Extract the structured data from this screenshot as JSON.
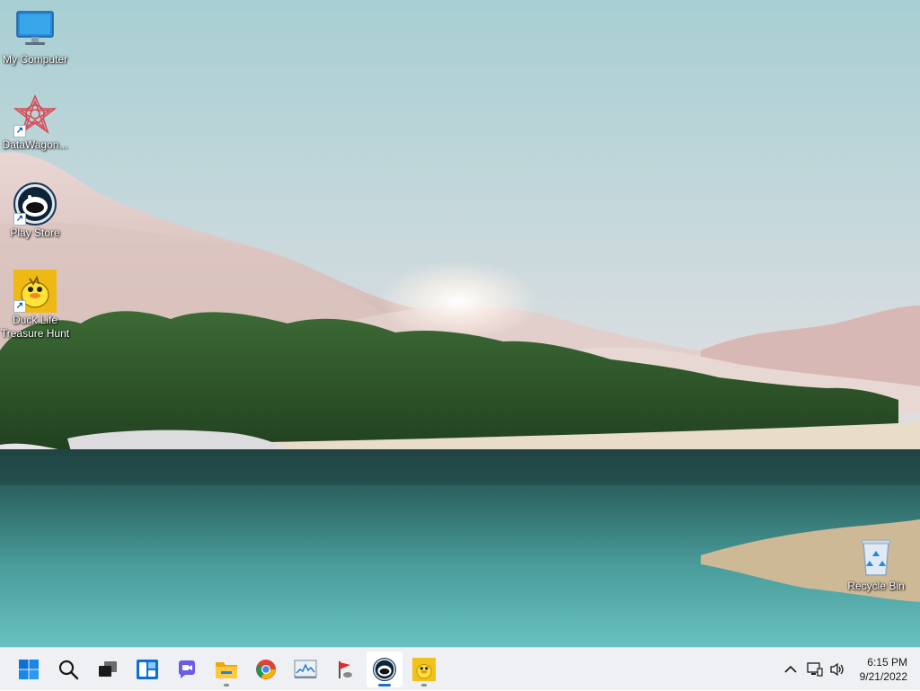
{
  "desktop": {
    "icons": [
      {
        "label": "My Computer",
        "icon": "monitor-icon"
      },
      {
        "label": "DataWagon...",
        "icon": "datawagon-icon"
      },
      {
        "label": "Play Store",
        "icon": "play-store-icon"
      },
      {
        "label": "Duck Life\nTreasure Hunt",
        "icon": "duck-life-icon"
      },
      {
        "label": "Recycle Bin",
        "icon": "recycle-bin-icon"
      }
    ]
  },
  "taskbar": {
    "apps": [
      {
        "name": "Start",
        "icon": "windows-start-icon"
      },
      {
        "name": "Search",
        "icon": "search-icon"
      },
      {
        "name": "Task View",
        "icon": "task-view-icon"
      },
      {
        "name": "Widgets",
        "icon": "widgets-icon"
      },
      {
        "name": "Chat",
        "icon": "chat-icon"
      },
      {
        "name": "File Explorer",
        "icon": "folder-icon",
        "running": true
      },
      {
        "name": "Google Chrome",
        "icon": "chrome-icon"
      },
      {
        "name": "Resource Monitor",
        "icon": "monitor-graph-icon"
      },
      {
        "name": "Flag App",
        "icon": "flag-icon"
      },
      {
        "name": "Play Store",
        "icon": "play-store-icon",
        "running": true,
        "active": true
      },
      {
        "name": "Duck Life Treasure Hunt",
        "icon": "duck-life-icon",
        "running": true
      }
    ],
    "tray": {
      "overflow_icon": "chevron-up-icon",
      "network_icon": "network-icon",
      "volume_icon": "volume-icon"
    },
    "clock": {
      "time": "6:15 PM",
      "date": "9/21/2022"
    }
  },
  "colors": {
    "taskbar_bg": "#eef0f3",
    "active_indicator": "#1f6fd1",
    "start_blue": "#0078d4"
  }
}
